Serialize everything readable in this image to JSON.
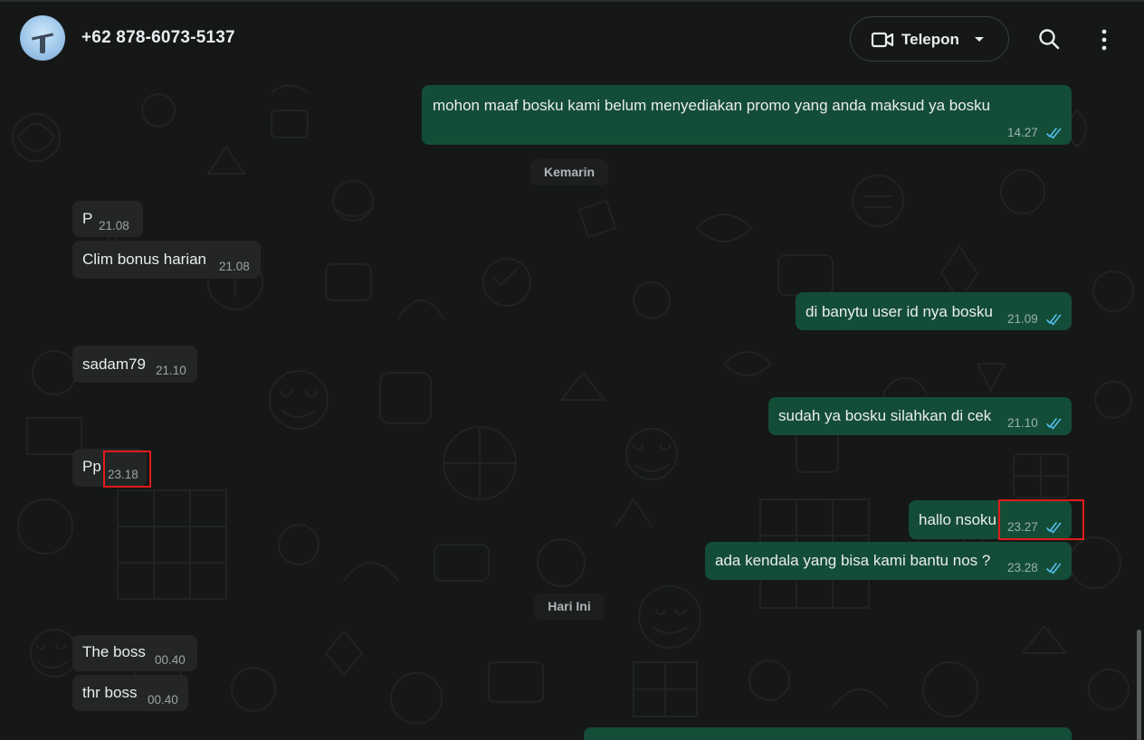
{
  "header": {
    "contact_name": "+62 878-6073-5137",
    "call_label": "Telepon",
    "avatar_icon": "profile-photo",
    "video_icon": "video-camera-icon",
    "search_icon": "search-icon",
    "menu_icon": "more-vertical-icon"
  },
  "colors": {
    "incoming_bubble": "#242626",
    "outgoing_bubble": "#144d37",
    "read_ticks": "#53bdeb",
    "highlight": "#e01b1b"
  },
  "date_dividers": {
    "yesterday": "Kemarin",
    "today": "Hari Ini"
  },
  "messages": [
    {
      "dir": "out",
      "text": "mohon maaf bosku kami belum menyediakan promo yang anda maksud ya bosku",
      "time": "14.27",
      "read": true
    },
    {
      "dir": "in",
      "text": "P",
      "time": "21.08"
    },
    {
      "dir": "in",
      "text": "Clim bonus harian",
      "time": "21.08"
    },
    {
      "dir": "out",
      "text": "di banytu user id nya bosku",
      "time": "21.09",
      "read": true
    },
    {
      "dir": "in",
      "text": "sadam79",
      "time": "21.10"
    },
    {
      "dir": "out",
      "text": "sudah ya bosku silahkan di cek",
      "time": "21.10",
      "read": true
    },
    {
      "dir": "in",
      "text": "Pp",
      "time": "23.18"
    },
    {
      "dir": "out",
      "text": "hallo nsoku",
      "time": "23.27",
      "read": true
    },
    {
      "dir": "out",
      "text": "ada kendala yang bisa kami bantu nos ?",
      "time": "23.28",
      "read": true
    },
    {
      "dir": "in",
      "text": "The boss",
      "time": "00.40"
    },
    {
      "dir": "in",
      "text": "thr boss",
      "time": "00.40"
    }
  ]
}
